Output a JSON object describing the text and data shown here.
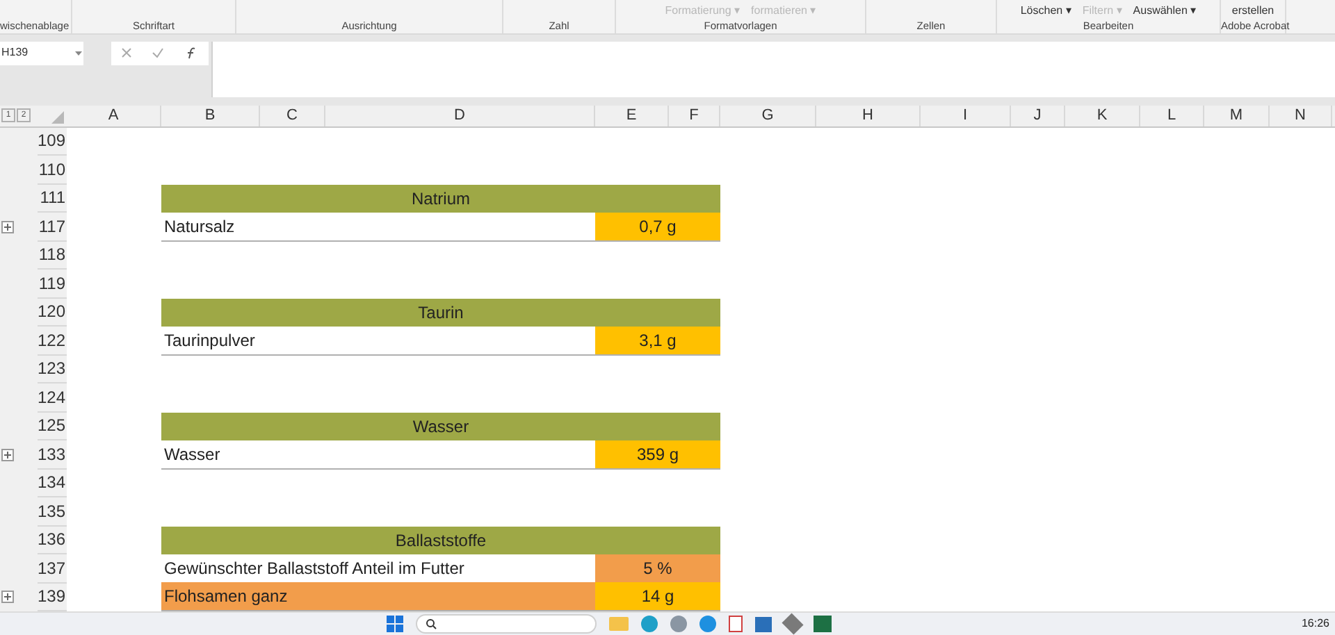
{
  "ribbon": {
    "groups": [
      {
        "label": "wischenablage"
      },
      {
        "label": "Schriftart"
      },
      {
        "label": "Ausrichtung"
      },
      {
        "label": "Zahl"
      },
      {
        "label": "Formatvorlagen",
        "items": [
          {
            "label": "Formatierung ▾",
            "disabled": true
          },
          {
            "label": "formatieren ▾",
            "disabled": true
          }
        ]
      },
      {
        "label": "Zellen"
      },
      {
        "label": "Bearbeiten",
        "items": [
          {
            "label": "Löschen ▾",
            "disabled": false
          },
          {
            "label": "Filtern ▾",
            "disabled": true
          },
          {
            "label": "Auswählen ▾",
            "disabled": false
          }
        ]
      },
      {
        "label": "Adobe Acrobat",
        "items": [
          {
            "label": "erstellen",
            "disabled": false
          }
        ]
      }
    ]
  },
  "formula_bar": {
    "name_box": "H139"
  },
  "sheet": {
    "outline_levels": [
      "1",
      "2"
    ],
    "columns": [
      "A",
      "B",
      "C",
      "D",
      "E",
      "F",
      "G",
      "H",
      "I",
      "J",
      "K",
      "L",
      "M",
      "N"
    ],
    "rows": [
      {
        "number": "109",
        "kind": "blank",
        "collapsed": false
      },
      {
        "number": "110",
        "kind": "blank",
        "collapsed": false
      },
      {
        "number": "111",
        "kind": "header",
        "title": "Natrium",
        "collapsed": false
      },
      {
        "number": "117",
        "kind": "value",
        "label": "Natursalz",
        "value": "0,7 g",
        "collapsed": true
      },
      {
        "number": "118",
        "kind": "blank",
        "collapsed": false
      },
      {
        "number": "119",
        "kind": "blank",
        "collapsed": false
      },
      {
        "number": "120",
        "kind": "header",
        "title": "Taurin",
        "collapsed": false
      },
      {
        "number": "122",
        "kind": "value",
        "label": "Taurinpulver",
        "value": "3,1 g",
        "collapsed": false
      },
      {
        "number": "123",
        "kind": "blank",
        "collapsed": false
      },
      {
        "number": "124",
        "kind": "blank",
        "collapsed": false
      },
      {
        "number": "125",
        "kind": "header",
        "title": "Wasser",
        "collapsed": false
      },
      {
        "number": "133",
        "kind": "value",
        "label": "Wasser",
        "value": "359 g",
        "collapsed": true
      },
      {
        "number": "134",
        "kind": "blank",
        "collapsed": false
      },
      {
        "number": "135",
        "kind": "blank",
        "collapsed": false
      },
      {
        "number": "136",
        "kind": "header",
        "title": "Ballaststoffe",
        "collapsed": false
      },
      {
        "number": "137",
        "kind": "input",
        "label": "Gewünschter Ballaststoff Anteil im Futter",
        "value": "5 %",
        "collapsed": false
      },
      {
        "number": "139",
        "kind": "highlight",
        "label": "Flohsamen ganz",
        "value": "14 g",
        "collapsed": true
      }
    ]
  },
  "taskbar": {
    "clock": "16:26"
  }
}
